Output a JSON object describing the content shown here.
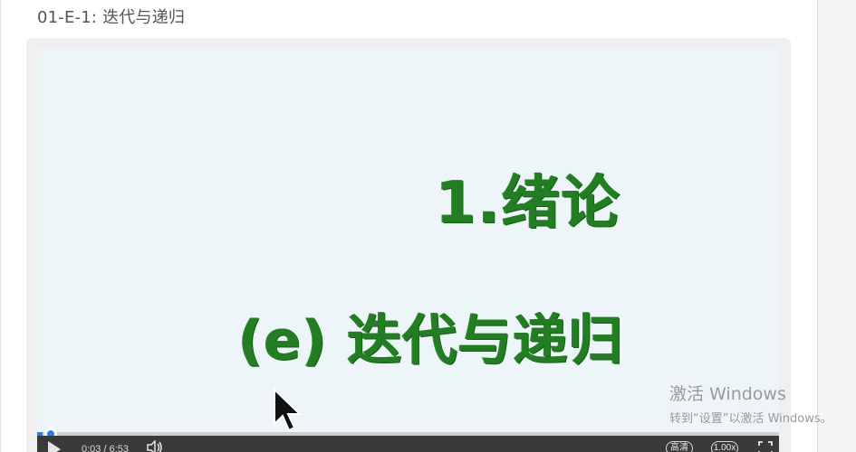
{
  "lesson": {
    "title": "01-E-1: 迭代与递归"
  },
  "slide": {
    "title": "1.绪论",
    "subtitle": "(e) 迭代与递归"
  },
  "player": {
    "time": "0:03 / 6:53",
    "progress_fraction": 0.0073,
    "quality_label": "高清",
    "speed_label": "1.00x",
    "icons": [
      "play-icon",
      "volume-icon",
      "fullscreen-icon",
      "cursor-arrow-icon"
    ]
  },
  "watermark": {
    "title": "激活 Windows",
    "subtitle": "转到“设置”以激活 Windows。"
  },
  "colors": {
    "slide_text": "#237d22",
    "progress": "#2f7de1",
    "controls_bg": "#3a3a3a"
  }
}
